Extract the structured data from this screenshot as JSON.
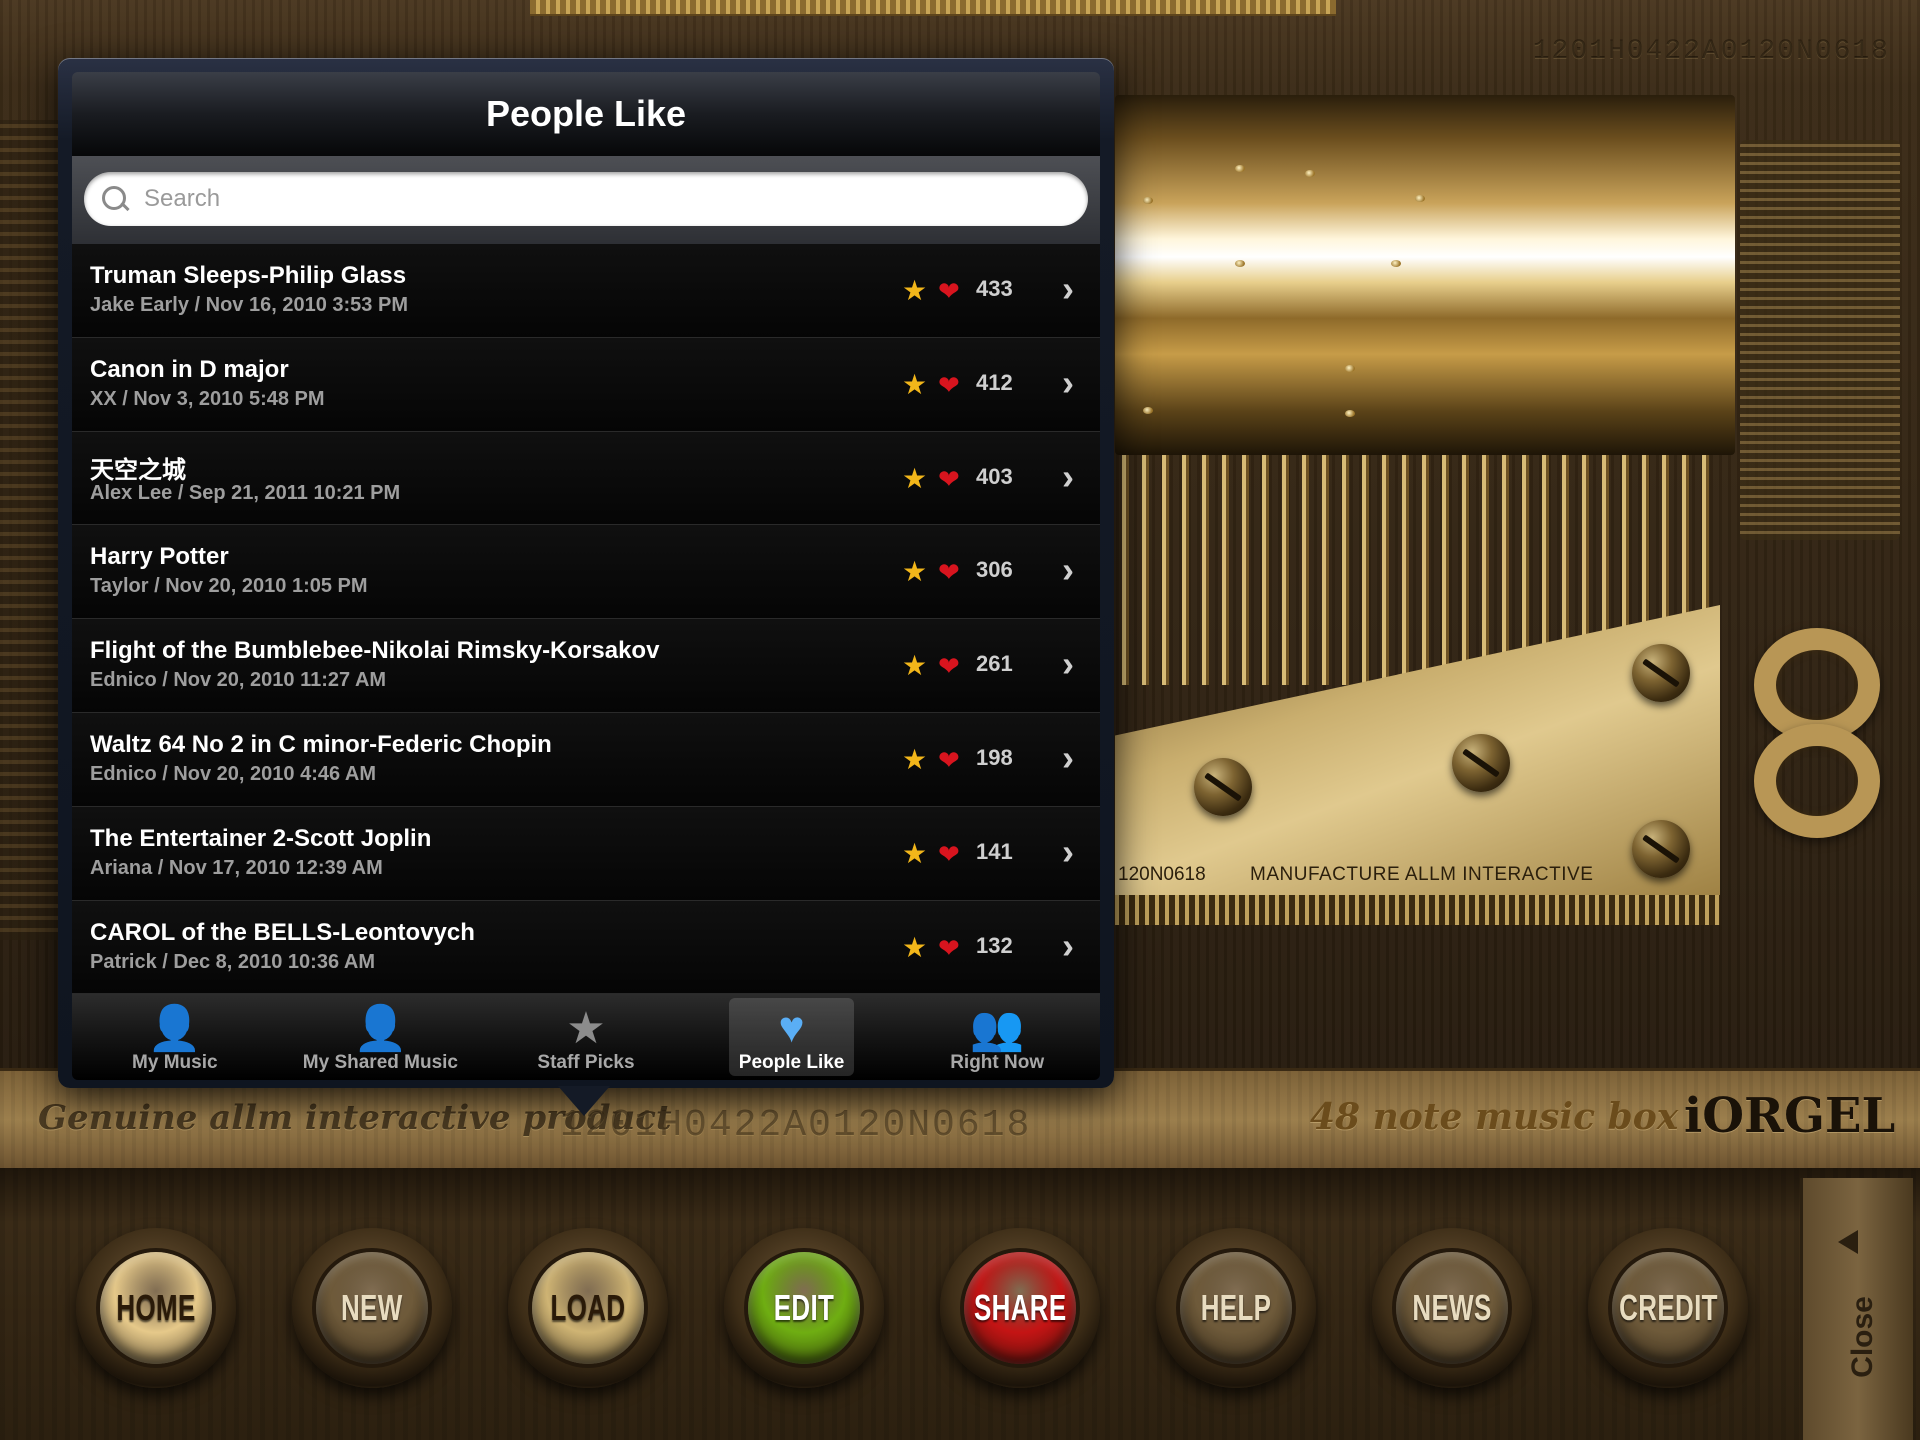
{
  "popover": {
    "title": "People Like",
    "search_placeholder": "Search"
  },
  "songs": [
    {
      "title": "Truman Sleeps-Philip Glass",
      "meta": "Jake Early / Nov 16, 2010 3:53 PM",
      "likes": "433"
    },
    {
      "title": "Canon in D major",
      "meta": "XX / Nov 3, 2010 5:48 PM",
      "likes": "412"
    },
    {
      "title": "天空之城",
      "meta": "Alex Lee / Sep 21, 2011 10:21 PM",
      "likes": "403"
    },
    {
      "title": "Harry Potter",
      "meta": "Taylor / Nov 20, 2010 1:05 PM",
      "likes": "306"
    },
    {
      "title": "Flight of the Bumblebee-Nikolai Rimsky-Korsakov",
      "meta": "Ednico / Nov 20, 2010 11:27 AM",
      "likes": "261"
    },
    {
      "title": "Waltz 64 No 2 in C minor-Federic Chopin",
      "meta": "Ednico / Nov 20, 2010 4:46 AM",
      "likes": "198"
    },
    {
      "title": "The Entertainer 2-Scott Joplin",
      "meta": "Ariana / Nov 17, 2010 12:39 AM",
      "likes": "141"
    },
    {
      "title": "CAROL of the BELLS-Leontovych",
      "meta": "Patrick / Dec 8, 2010 10:36 AM",
      "likes": "132"
    }
  ],
  "row_icons": {
    "favorite": "star-icon",
    "like": "heart-icon",
    "disclosure": "chevron-right-icon"
  },
  "tabs": [
    {
      "label": "My Music",
      "icon": "person-icon",
      "active": false
    },
    {
      "label": "My Shared Music",
      "icon": "person-broadcast-icon",
      "active": false
    },
    {
      "label": "Staff Picks",
      "icon": "star-icon",
      "active": false
    },
    {
      "label": "People Like",
      "icon": "heart-icon",
      "active": true
    },
    {
      "label": "Right Now",
      "icon": "group-icon",
      "active": false
    }
  ],
  "background": {
    "serial_top": "1201H0422A0120N0618",
    "serial_bottom": "1201H0422A0120N0618",
    "plate_serial": "120N0618",
    "plate_text": "MANUFACTURE ALLM INTERACTIVE",
    "genuine_text": "Genuine allm interactive product",
    "note_label": "48 note music box",
    "brand": "iORGEL"
  },
  "controls": [
    {
      "label": "HOME",
      "face": "#e6c98a",
      "text": "#2a1a08"
    },
    {
      "label": "NEW",
      "face": "#6e5a3a",
      "text": "#e8dcc0"
    },
    {
      "label": "LOAD",
      "face": "#cfb474",
      "text": "#2a1a08"
    },
    {
      "label": "EDIT",
      "face": "#6fae12",
      "text": "#ffffff"
    },
    {
      "label": "SHARE",
      "face": "#c41414",
      "text": "#ffffff"
    },
    {
      "label": "HELP",
      "face": "#6e5a3a",
      "text": "#e8dcc0"
    },
    {
      "label": "NEWS",
      "face": "#6e5a3a",
      "text": "#e8dcc0"
    },
    {
      "label": "CREDIT",
      "face": "#6e5a3a",
      "text": "#e8dcc0"
    }
  ],
  "close_tab": {
    "label": "Close"
  },
  "colors": {
    "accent_blue": "#5aaef5",
    "star": "#f2b61a",
    "heart": "#d8141e"
  }
}
